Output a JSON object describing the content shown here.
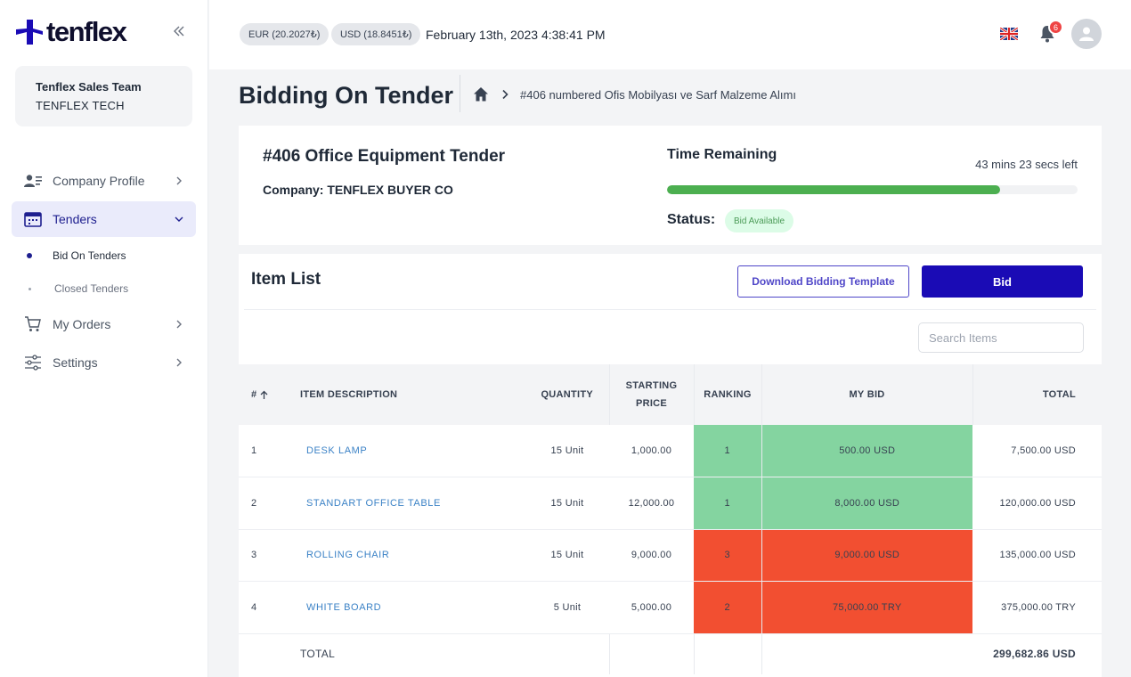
{
  "brand": {
    "logo_text": "tenflex",
    "logo_color": "#1a0bb5"
  },
  "sidebar": {
    "team_name": "Tenflex Sales Team",
    "team_company": "TENFLEX TECH",
    "items": [
      {
        "label": "Company Profile",
        "icon": "company-profile-icon"
      },
      {
        "label": "Tenders",
        "icon": "calendar-icon",
        "active": true
      },
      {
        "label": "My Orders",
        "icon": "cart-icon"
      },
      {
        "label": "Settings",
        "icon": "sliders-icon"
      }
    ],
    "sub_items": [
      {
        "label": "Bid On Tenders",
        "active": true
      },
      {
        "label": "Closed Tenders"
      }
    ]
  },
  "topbar": {
    "rates": [
      "EUR (20.2027₺)",
      "USD (18.8451₺)"
    ],
    "datetime": "February 13th, 2023 4:38:41 PM",
    "notification_count": "6"
  },
  "page": {
    "title": "Bidding On Tender",
    "breadcrumb": "#406 numbered Ofis Mobilyası ve Sarf Malzeme Alımı"
  },
  "tender": {
    "title": "#406 Office Equipment Tender",
    "company": "Company: TENFLEX BUYER CO",
    "time_label": "Time Remaining",
    "time_left": "43 mins 23 secs left",
    "progress": 0.812,
    "status_label": "Status:",
    "status_value": "Bid Available"
  },
  "item_list": {
    "title": "Item List",
    "download_label": "Download Bidding Template",
    "bid_label": "Bid",
    "search_placeholder": "Search Items",
    "columns": {
      "num": "#",
      "desc": "ITEM DESCRIPTION",
      "qty": "QUANTITY",
      "price_line1": "STARTING",
      "price_line2": "PRICE",
      "rank": "RANKING",
      "bid": "MY BID",
      "total": "TOTAL"
    },
    "rows": [
      {
        "num": "1",
        "desc": "DESK LAMP",
        "qty": "15 Unit",
        "price": "1,000.00",
        "rank": "1",
        "bid": "500.00 USD",
        "total": "7,500.00 USD",
        "winning": true
      },
      {
        "num": "2",
        "desc": "STANDART OFFICE TABLE",
        "qty": "15 Unit",
        "price": "12,000.00",
        "rank": "1",
        "bid": "8,000.00 USD",
        "total": "120,000.00 USD",
        "winning": true
      },
      {
        "num": "3",
        "desc": "ROLLING CHAIR",
        "qty": "15 Unit",
        "price": "9,000.00",
        "rank": "3",
        "bid": "9,000.00 USD",
        "total": "135,000.00 USD",
        "winning": false
      },
      {
        "num": "4",
        "desc": "WHITE BOARD",
        "qty": "5 Unit",
        "price": "5,000.00",
        "rank": "2",
        "bid": "75,000.00 TRY",
        "total": "375,000.00 TRY",
        "winning": false
      }
    ],
    "total_label": "TOTAL",
    "total_value": "299,682.86 USD"
  },
  "colors": {
    "accent": "#1a0bb5",
    "good": "#84d4a0",
    "bad": "#f24f31",
    "progress": "#4caf50"
  }
}
